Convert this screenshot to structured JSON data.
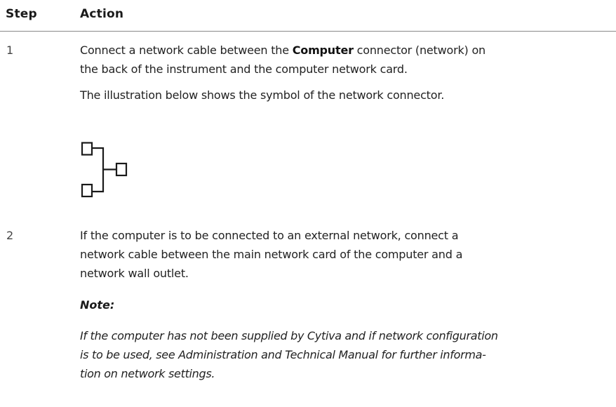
{
  "table": {
    "header": {
      "step": "Step",
      "action": "Action"
    },
    "steps": [
      {
        "number": "1",
        "text_before": "Connect a network cable between the ",
        "text_bold": "Computer",
        "text_after_line1": " connector (network) on",
        "text_line2": "the back of the instrument and the computer network card.",
        "illustration_caption": "The illustration below shows the symbol of the network connector.",
        "illustration_icon": "network-connector-symbol"
      },
      {
        "number": "2",
        "line1": "If the computer is to be connected to an external network, connect a",
        "line2": "network cable between the main network card of the computer and a",
        "line3": "network wall outlet.",
        "note_title": "Note:",
        "note_line1": "If the computer has not been supplied by Cytiva and if network configuration",
        "note_line2": "is to be used, see Administration and Technical Manual for further informa-",
        "note_line3": "tion on network settings."
      }
    ]
  }
}
